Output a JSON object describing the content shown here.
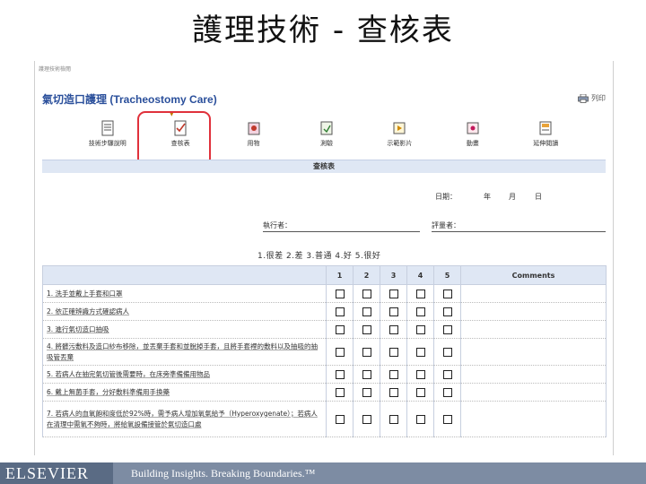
{
  "slide_title": "護理技術 - 查核表",
  "breadcrumb": "護理技術檢閱",
  "page_title": "氣切造口護理 (Tracheostomy Care)",
  "print_label": "列印",
  "nav": [
    {
      "label": "技術步驟說明",
      "icon": "document-icon"
    },
    {
      "label": "查核表",
      "icon": "checklist-icon"
    },
    {
      "label": "用物",
      "icon": "supplies-icon"
    },
    {
      "label": "測驗",
      "icon": "quiz-icon"
    },
    {
      "label": "示範影片",
      "icon": "video-icon"
    },
    {
      "label": "動畫",
      "icon": "animation-icon"
    },
    {
      "label": "延伸閱讀",
      "icon": "reading-icon"
    }
  ],
  "section_title": "查核表",
  "meta": {
    "date_label": "日期：",
    "year": "年",
    "month": "月",
    "day": "日",
    "performer_label": "執行者：",
    "evaluator_label": "評量者："
  },
  "scale_note": "1.很差 2.差 3.普通 4.好 5.很好",
  "table": {
    "headers": [
      "1",
      "2",
      "3",
      "4",
      "5",
      "Comments"
    ],
    "rows": [
      "1. 洗手並戴上手套和口罩",
      "2. 依正確辨識方式確認病人",
      "3. 進行氣切造口抽吸",
      "4. 將髒污敷料及造口紗布移除，並丟棄手套和並脫掉手套，且將手套裡的敷料以及抽吸的抽吸管丟棄",
      "5. 若病人在抽完氣切管後需要時，在床旁準備備用物品",
      "6. 戴上無菌手套，分好敷料準備用手換藥",
      "7. 若病人的血氧飽和度低於92%時，需予病人增加氧氣給予（Hyperoxygenate）；若病人在清理中需氧不夠時，將給氧設備接管於氣切造口處"
    ]
  },
  "footer": {
    "brand": "ELSEVIER",
    "tagline": "Building Insights. Breaking Boundaries.™"
  }
}
